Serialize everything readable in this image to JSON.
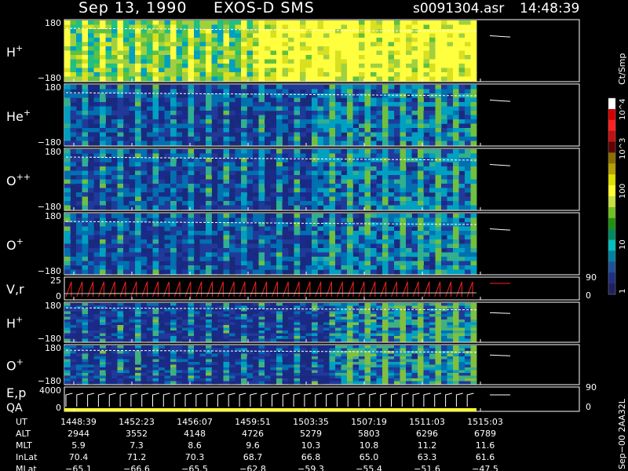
{
  "header": {
    "date": "Sep 13, 1990",
    "instrument": "EXOS-D SMS",
    "file": "s0091304.asr",
    "time": "14:48:39"
  },
  "colorbar": {
    "unit": "Ct/Smp",
    "labels": [
      "10^4",
      "10^3",
      "100",
      "10",
      "1"
    ],
    "colors": [
      "#ffffff",
      "#d40000",
      "#ff2020",
      "#c01010",
      "#600000",
      "#8b7000",
      "#b8a000",
      "#e0e000",
      "#ffff30",
      "#c8e040",
      "#70c020",
      "#209010",
      "#008a60",
      "#00c0c0",
      "#0080a0",
      "#205098",
      "#203080",
      "#202060"
    ]
  },
  "panels": [
    {
      "label": "H",
      "sup": "+",
      "ytop": "180",
      "ybot": "−180",
      "colors": "high"
    },
    {
      "label": "He",
      "sup": "+",
      "ytop": "180",
      "ybot": "−180",
      "colors": "med"
    },
    {
      "label": "O",
      "sup": "++",
      "ytop": "180",
      "ybot": "−180",
      "colors": "med"
    },
    {
      "label": "O",
      "sup": "+",
      "ytop": "180",
      "ybot": "−180",
      "colors": "med"
    },
    {
      "label": "V,r",
      "sup": "",
      "ytop": "25",
      "ybot": "0",
      "right_top": "90",
      "right_bot": "0"
    },
    {
      "label": "H",
      "sup": "+",
      "ytop": "180",
      "ybot": "−180",
      "colors": "low"
    },
    {
      "label": "O",
      "sup": "+",
      "ytop": "180",
      "ybot": "−180",
      "colors": "low"
    },
    {
      "label": "E,p",
      "sup": "",
      "label2": "QA",
      "ytop": "4000",
      "ybot": "0",
      "right_top": "90",
      "right_bot": "0"
    }
  ],
  "footer": {
    "rows": [
      {
        "name": "UT",
        "values": [
          "1448:39",
          "1452:23",
          "1456:07",
          "1459:51",
          "1503:35",
          "1507:19",
          "1511:03",
          "1515:03"
        ]
      },
      {
        "name": "ALT",
        "values": [
          "2944",
          "3552",
          "4148",
          "4726",
          "5279",
          "5803",
          "6296",
          "6789"
        ]
      },
      {
        "name": "MLT",
        "values": [
          "5.9",
          "7.3",
          "8.6",
          "9.6",
          "10.3",
          "10.8",
          "11.2",
          "11.6"
        ]
      },
      {
        "name": "InLat",
        "values": [
          "70.4",
          "71.2",
          "70.3",
          "68.7",
          "66.8",
          "65.0",
          "63.3",
          "61.6"
        ]
      },
      {
        "name": "MLat",
        "values": [
          "−65.1",
          "−66.6",
          "−65.5",
          "−62.8",
          "−59.3",
          "−55.4",
          "−51.6",
          "−47.5"
        ]
      }
    ],
    "vertical_note": "Sep−00 2AA32L"
  },
  "chart_data": {
    "type": "heatmap",
    "title": "Sep 13, 1990   EXOS-D SMS",
    "x": [
      "1448:39",
      "1452:23",
      "1456:07",
      "1459:51",
      "1503:35",
      "1507:19",
      "1511:03",
      "1515:03"
    ],
    "series": [
      {
        "name": "H+",
        "ylim": [
          -180,
          180
        ]
      },
      {
        "name": "He+",
        "ylim": [
          -180,
          180
        ]
      },
      {
        "name": "O++",
        "ylim": [
          -180,
          180
        ]
      },
      {
        "name": "O+",
        "ylim": [
          -180,
          180
        ]
      },
      {
        "name": "V,r",
        "ylim": [
          0,
          25
        ]
      },
      {
        "name": "H+",
        "ylim": [
          -180,
          180
        ]
      },
      {
        "name": "O+",
        "ylim": [
          -180,
          180
        ]
      },
      {
        "name": "E,p",
        "ylim": [
          0,
          4000
        ]
      }
    ],
    "colorscale": {
      "unit": "Ct/Smp",
      "scale": "log",
      "range": [
        1,
        10000
      ]
    }
  }
}
